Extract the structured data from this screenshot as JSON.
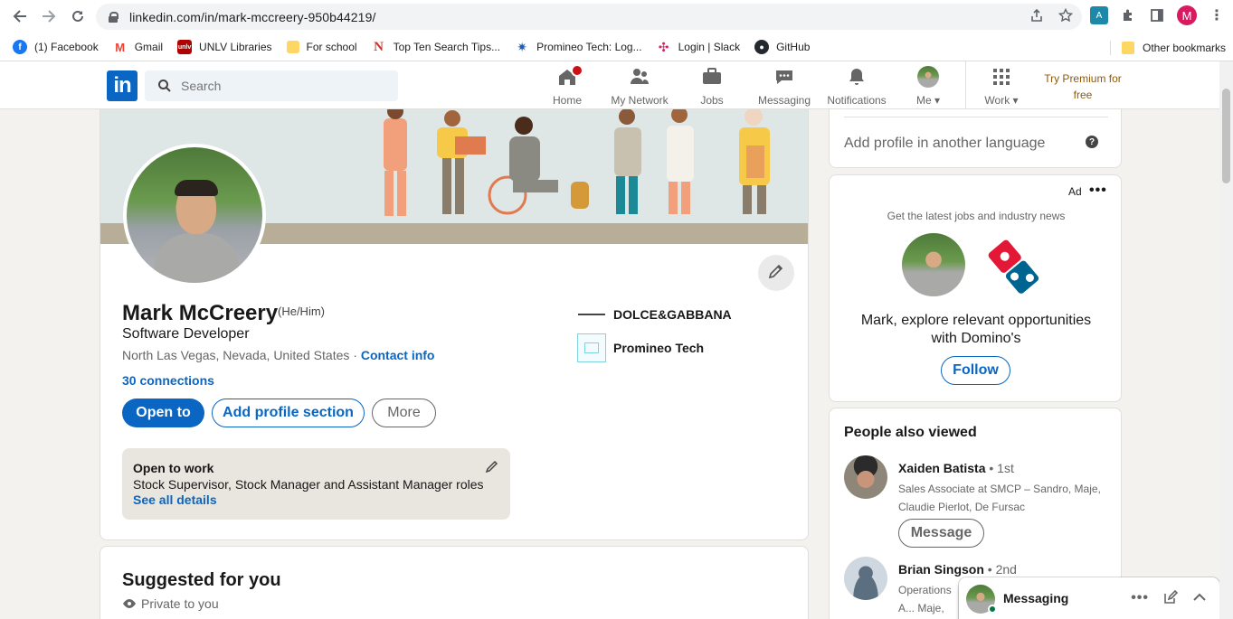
{
  "browser": {
    "url": "linkedin.com/in/mark-mccreery-950b44219/",
    "profile_initial": "M",
    "bookmarks": [
      {
        "label": "(1) Facebook",
        "icon": "facebook-icon"
      },
      {
        "label": "Gmail",
        "icon": "gmail-icon"
      },
      {
        "label": "UNLV Libraries",
        "icon": "unlv-icon"
      },
      {
        "label": "For school",
        "icon": "folder-icon"
      },
      {
        "label": "Top Ten Search Tips...",
        "icon": "n-icon"
      },
      {
        "label": "Promineo Tech: Log...",
        "icon": "promineo-icon"
      },
      {
        "label": "Login | Slack",
        "icon": "slack-icon"
      },
      {
        "label": "GitHub",
        "icon": "github-icon"
      }
    ],
    "other_bookmarks": "Other bookmarks"
  },
  "header": {
    "search_placeholder": "Search",
    "nav": {
      "home": "Home",
      "network": "My Network",
      "jobs": "Jobs",
      "messaging": "Messaging",
      "notifications": "Notifications",
      "me": "Me",
      "work": "Work"
    },
    "premium_line1": "Try Premium for",
    "premium_line2": "free"
  },
  "profile": {
    "name": "Mark McCreery",
    "pronouns": "(He/Him)",
    "headline": "Software Developer",
    "location": "North Las Vegas, Nevada, United States ·",
    "contact_info": "Contact info",
    "connections": "30 connections",
    "buttons": {
      "open_to": "Open to",
      "add_section": "Add profile section",
      "more": "More"
    },
    "open_to_work": {
      "title": "Open to work",
      "roles": "Stock Supervisor, Stock Manager and Assistant Manager roles",
      "link": "See all details"
    },
    "experience": [
      {
        "company": "DOLCE&GABBANA"
      },
      {
        "company": "Promineo Tech"
      }
    ]
  },
  "suggested": {
    "title": "Suggested for you",
    "subtitle": "Private to you"
  },
  "sidebar": {
    "language": "Add profile in another language",
    "ad": {
      "label": "Ad",
      "subtitle": "Get the latest jobs and industry news",
      "message": "Mark, explore relevant opportunities with Domino's",
      "follow": "Follow"
    },
    "people_also_viewed": {
      "title": "People also viewed",
      "people": [
        {
          "name": "Xaiden Batista",
          "degree": "• 1st",
          "role": "Sales Associate at SMCP – Sandro, Maje, Claudie Pierlot, De Fursac",
          "action": "Message"
        },
        {
          "name": "Brian Singson",
          "degree": "• 2nd",
          "role": "Operations A... Maje, Claudie..."
        }
      ]
    }
  },
  "messaging": {
    "label": "Messaging"
  },
  "colors": {
    "brand": "#0a66c2",
    "background": "#f3f2ef",
    "notification_badge": "#cc1016"
  }
}
